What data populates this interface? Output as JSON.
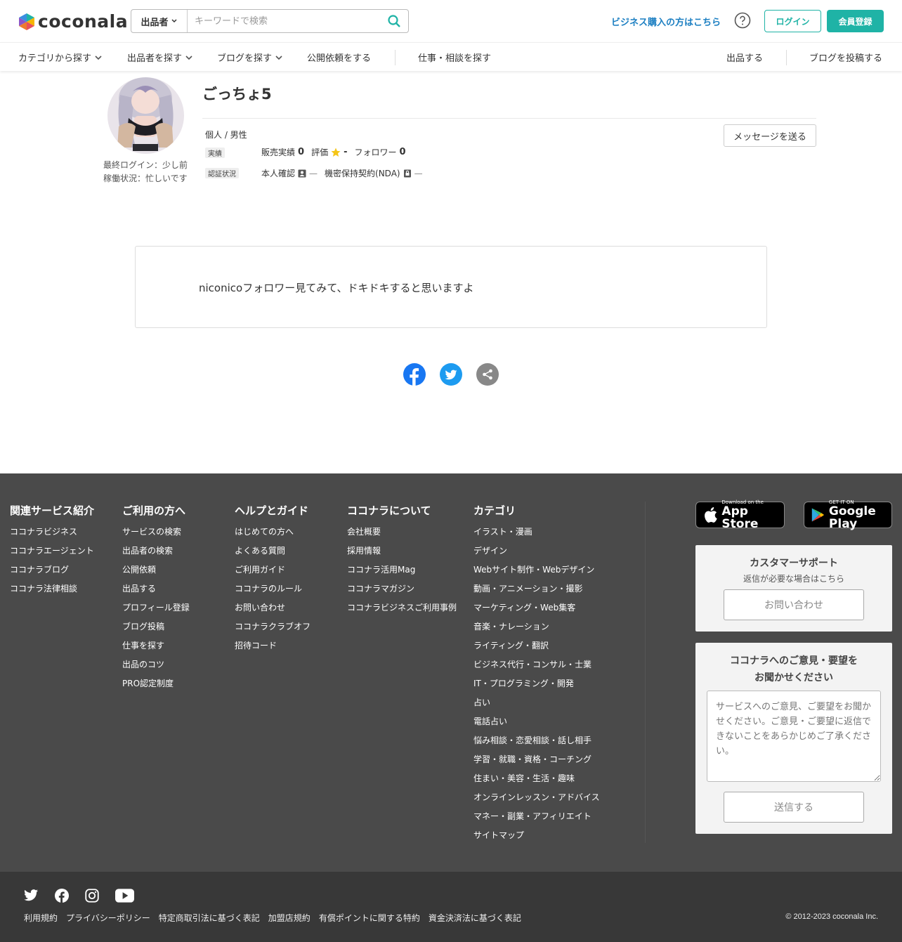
{
  "header": {
    "logo_text": "coconala",
    "search_type": "出品者",
    "search_placeholder": "キーワードで検索",
    "business_link": "ビジネス購入の方はこちら",
    "login_label": "ログイン",
    "signup_label": "会員登録"
  },
  "nav": {
    "left": [
      "カテゴリから探す",
      "出品者を探す",
      "ブログを探す",
      "公開依頼をする"
    ],
    "jobs": "仕事・相談を探す",
    "right": [
      "出品する",
      "ブログを投稿する"
    ]
  },
  "profile": {
    "username": "ごっちょ5",
    "last_login": "最終ログイン：少し前",
    "status": "稼働状況：忙しいです",
    "type": "個人 / 男性",
    "stats_tag": "実績",
    "sales_label": "販売実績",
    "sales_value": "0",
    "rating_label": "評価",
    "rating_value": "-",
    "followers_label": "フォロワー",
    "followers_value": "0",
    "verify_tag": "認証状況",
    "identity_label": "本人確認",
    "identity_value": "—",
    "nda_label": "機密保持契約(NDA)",
    "nda_value": "—",
    "message_button": "メッセージを送る"
  },
  "blog": {
    "text": "niconicoフォロワー見てみて、ドキドキすると思いますよ"
  },
  "share_icons": [
    "facebook-icon",
    "twitter-icon",
    "share-icon"
  ],
  "footer": {
    "columns": [
      {
        "title": "関連サービス紹介",
        "items": [
          "ココナラビジネス",
          "ココナラエージェント",
          "ココナラブログ",
          "ココナラ法律相談"
        ]
      },
      {
        "title": "ご利用の方へ",
        "items": [
          "サービスの検索",
          "出品者の検索",
          "公開依頼",
          "出品する",
          "プロフィール登録",
          "ブログ投稿",
          "仕事を探す",
          "出品のコツ",
          "PRO認定制度"
        ]
      },
      {
        "title": "ヘルプとガイド",
        "items": [
          "はじめての方へ",
          "よくある質問",
          "ご利用ガイド",
          "ココナラのルール",
          "お問い合わせ",
          "ココナラクラブオフ",
          "招待コード"
        ]
      },
      {
        "title": "ココナラについて",
        "items": [
          "会社概要",
          "採用情報",
          "ココナラ活用Mag",
          "ココナラマガジン",
          "ココナラビジネスご利用事例"
        ]
      },
      {
        "title": "カテゴリ",
        "items": [
          "イラスト・漫画",
          "デザイン",
          "Webサイト制作・Webデザイン",
          "動画・アニメーション・撮影",
          "マーケティング・Web集客",
          "音楽・ナレーション",
          "ライティング・翻訳",
          "ビジネス代行・コンサル・士業",
          "IT・プログラミング・開発",
          "占い",
          "電話占い",
          "悩み相談・恋愛相談・話し相手",
          "学習・就職・資格・コーチング",
          "住まい・美容・生活・趣味",
          "オンラインレッスン・アドバイス",
          "マネー・副業・アフィリエイト",
          "サイトマップ"
        ]
      }
    ],
    "app_store": {
      "small": "Download on the",
      "big": "App Store"
    },
    "google_play": {
      "small": "GET IT ON",
      "big": "Google Play"
    },
    "support": {
      "title": "カスタマーサポート",
      "subtitle": "返信が必要な場合はこちら",
      "button": "お問い合わせ"
    },
    "feedback": {
      "title_line1": "ココナラへのご意見・要望を",
      "title_line2": "お聞かせください",
      "placeholder": "サービスへのご意見、ご要望をお聞かせください。ご意見・ご要望に返信できないことをあらかじめご了承ください。",
      "button": "送信する"
    },
    "legal": [
      "利用規約",
      "プライバシーポリシー",
      "特定商取引法に基づく表記",
      "加盟店規約",
      "有償ポイントに関する特約",
      "資金決済法に基づく表記"
    ],
    "copyright": "© 2012-2023 coconala Inc."
  },
  "colors": {
    "accent": "#1fb3a6",
    "link": "#1c7fc2",
    "footer_bg": "#4a4a4a",
    "footer_bottom_bg": "#383838"
  }
}
